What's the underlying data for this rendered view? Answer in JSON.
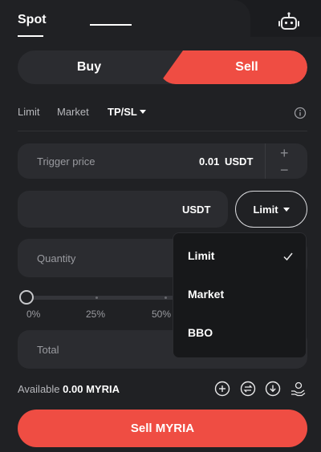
{
  "tabs": {
    "spot_label": "Spot"
  },
  "side": {
    "buy_label": "Buy",
    "sell_label": "Sell"
  },
  "order_types": [
    {
      "label": "Limit"
    },
    {
      "label": "Market"
    },
    {
      "label": "TP/SL"
    }
  ],
  "trigger": {
    "label": "Trigger price",
    "value": "0.01",
    "unit": "USDT"
  },
  "price": {
    "unit": "USDT",
    "type_label": "Limit"
  },
  "quantity": {
    "label": "Quantity"
  },
  "slider": {
    "ticks": [
      "0%",
      "25%",
      "50%"
    ],
    "value_fraction": 0
  },
  "total": {
    "label": "Total"
  },
  "dropdown": {
    "options": [
      "Limit",
      "Market",
      "BBO"
    ],
    "selected": "Limit"
  },
  "available": {
    "label": "Available",
    "value": "0.00 MYRIA"
  },
  "action": {
    "sell_label": "Sell MYRIA"
  },
  "colors": {
    "accent": "#ef4d43",
    "background": "#202124",
    "field": "#2b2c30"
  },
  "icons": [
    "robot-icon",
    "info-icon",
    "plus-icon",
    "minus-icon",
    "check-icon",
    "add-circle-icon",
    "transfer-icon",
    "download-icon",
    "coin-hand-icon"
  ]
}
